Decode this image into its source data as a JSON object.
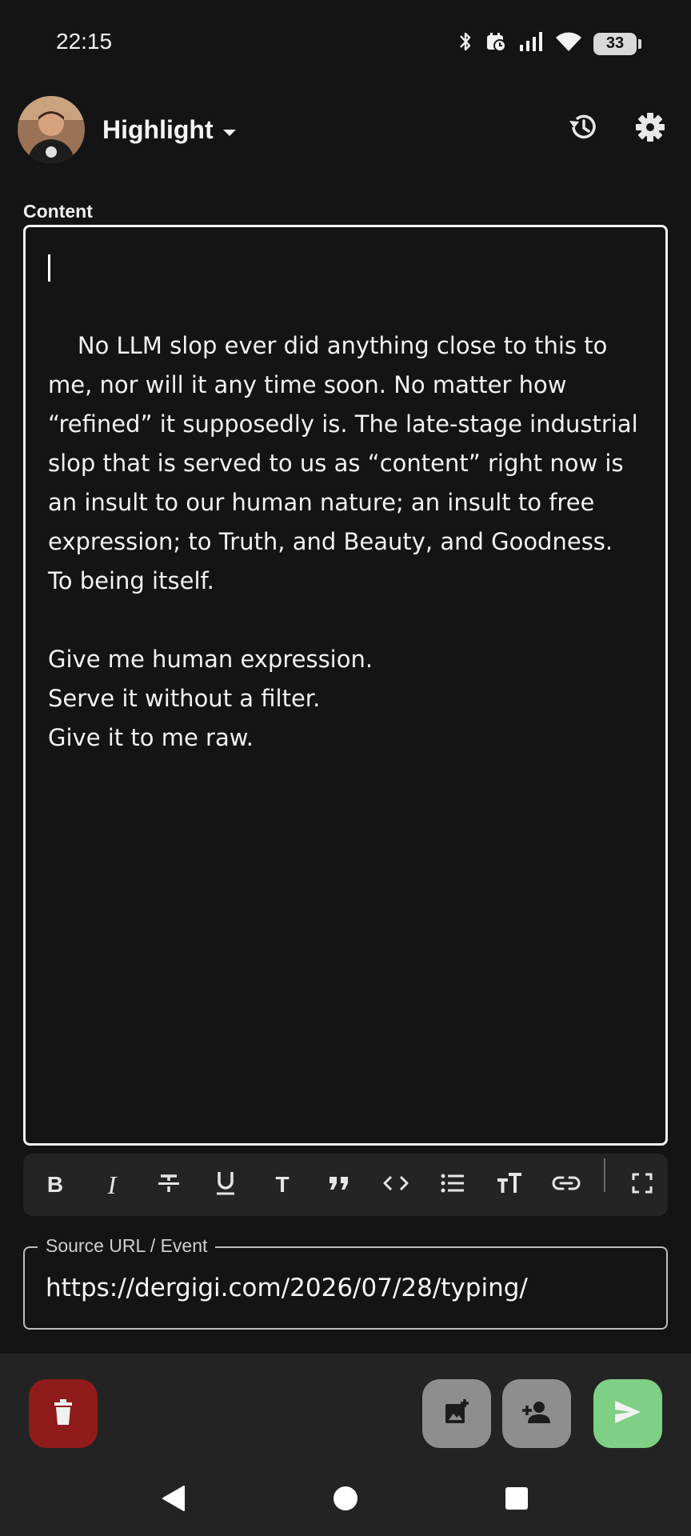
{
  "status_bar": {
    "time": "22:15",
    "battery_level": "33",
    "icons": [
      "bluetooth-icon",
      "calendar-clock-icon",
      "signal-icon",
      "wifi-icon",
      "battery-icon"
    ]
  },
  "header": {
    "title": "Highlight",
    "dropdown_icon": "caret-down-icon",
    "actions": [
      "history-icon",
      "settings-gear-icon"
    ]
  },
  "editor": {
    "label": "Content",
    "text": "No LLM slop ever did anything close to this to me, nor will it any time soon. No matter how “refined” it supposedly is. The late-stage industrial slop that is served to us as “content” right now is an insult to our human nature; an insult to free expression; to Truth, and Beauty, and Goodness. To being itself.\n\nGive me human expression.\nServe it without a filter.\nGive it to me raw."
  },
  "toolbar": {
    "buttons": [
      "bold",
      "italic",
      "strikethrough",
      "underline",
      "text-style",
      "quote",
      "code",
      "bulleted-list",
      "text-size",
      "link",
      "fullscreen"
    ],
    "bold_label": "B",
    "italic_label": "I",
    "underline_label": "U",
    "text_label": "T",
    "code_label": "<>"
  },
  "source": {
    "label": "Source URL / Event",
    "value": "https://dergigi.com/2026/07/28/typing/"
  },
  "actions": {
    "delete_icon": "trash-icon",
    "image_icon": "add-image-icon",
    "mention_icon": "add-person-icon",
    "send_icon": "send-icon",
    "colors": {
      "delete": "#8f1b1b",
      "neutral": "#8e8e8e",
      "send": "#7fcf85"
    }
  },
  "nav": {
    "icons": [
      "back-icon",
      "home-icon",
      "recents-icon"
    ]
  }
}
